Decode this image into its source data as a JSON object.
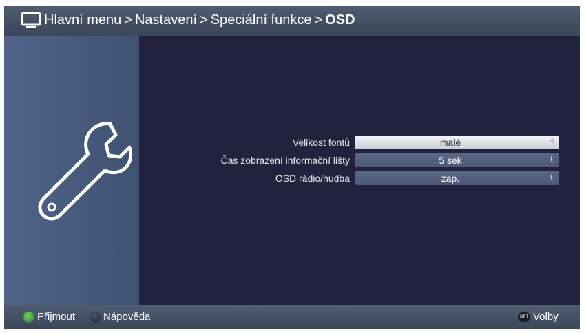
{
  "colors": {
    "screen_bg": "#22223e",
    "panel": "#506488",
    "header_bar": "#4a576b",
    "accept_button": "#3e8a34",
    "help_button": "#2a3448"
  },
  "header": {
    "icon": "tv-icon",
    "breadcrumb": [
      {
        "label": "Hlavní menu"
      },
      {
        "label": "Nastavení"
      },
      {
        "label": "Speciální funkce"
      },
      {
        "label": "OSD"
      }
    ],
    "separator": ">"
  },
  "left_panel": {
    "icon": "wrench-icon"
  },
  "settings": [
    {
      "label": "Velikost fontů",
      "value": "malé",
      "selected": true,
      "control_icon": "hand-pointer-icon"
    },
    {
      "label": "Čas zobrazení informační lišty",
      "value": "5 sek",
      "selected": false,
      "control_icon": "arrow-down-icon"
    },
    {
      "label": "OSD rádio/hudba",
      "value": "zap.",
      "selected": false,
      "control_icon": "arrow-down-icon"
    }
  ],
  "footer": {
    "accept_label": "Přijmout",
    "help_label": "Nápověda",
    "options_label": "Volby",
    "options_icon_text": "OPT"
  }
}
